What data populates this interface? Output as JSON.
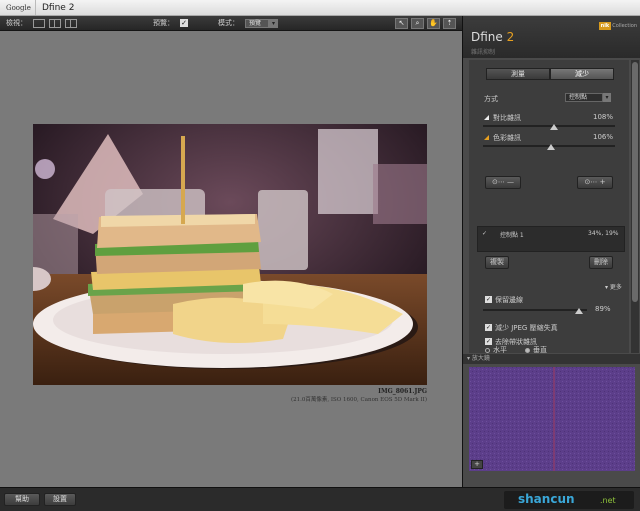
{
  "window": {
    "tab_label": "Google",
    "title": "Dfine 2"
  },
  "toolbar": {
    "view_label": "檢視：",
    "preview_label": "預覽：",
    "preview_checked": "✓",
    "mode_label": "模式：",
    "mode_value": "預覽",
    "icons": [
      "pointer-icon",
      "zoom-icon",
      "hand-icon",
      "loupe-pin-icon"
    ]
  },
  "image": {
    "filename": "IMG_8061.JPG",
    "info": "(21.0百萬像素, ISO 1600, Canon EOS 5D Mark II)"
  },
  "panel": {
    "app_name": "Dfine",
    "app_version": "2",
    "subtitle": "雜訊抑制",
    "logo_text": "nik",
    "logo_sub": "Collection",
    "tabs": [
      "測量",
      "減少"
    ],
    "method_label": "方式",
    "method_value": "控制點",
    "contrast_label": "對比雜訊",
    "contrast_value": "108%",
    "color_label": "色彩雜訊",
    "color_value": "106%",
    "cp_label": "控制點 1",
    "cp_values": "34%, 19%",
    "copy_button": "複製",
    "delete_button": "刪除",
    "more_label": "▾ 更多",
    "preserve_label": "保留邊線",
    "preserve_value": "89%",
    "jpeg_label": "減少 JPEG 壓縮失真",
    "debanding_label": "去除帶狀雜訊",
    "horizontal_label": "水平",
    "vertical_label": "垂直",
    "loupe_label": "放大鏡"
  },
  "bottom": {
    "help_button": "幫助",
    "settings_button": "設置"
  },
  "watermark": {
    "main": "shancun",
    "sub": ".net"
  },
  "colors": {
    "accent": "#e7a020",
    "loupe_bg": "#5c3e8a",
    "canvas_bg": "#7a7a7a"
  }
}
